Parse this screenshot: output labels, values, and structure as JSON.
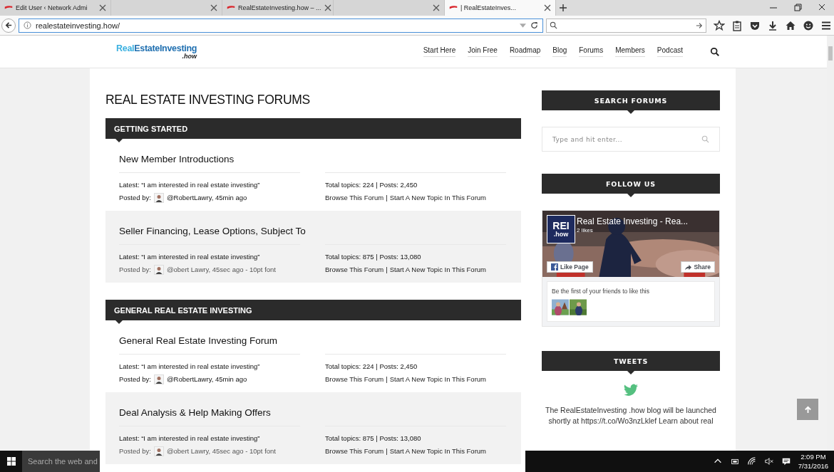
{
  "browser": {
    "tabs": [
      {
        "title": "Edit User ‹ Network Admi",
        "has_icon": true,
        "selected": false
      },
      {
        "has_icon": false,
        "selected": false
      },
      {
        "title": "RealEstateInvesting.how – ...",
        "has_icon": true,
        "selected": false
      },
      {
        "has_icon": false,
        "selected": false
      },
      {
        "title": "| RealEstateInves...",
        "has_icon": true,
        "selected": true
      }
    ],
    "address": "realestateinvesting.how/"
  },
  "site": {
    "logo": {
      "part_a": "Real",
      "part_b": "EstateInvesting",
      "sub": ".how"
    },
    "nav": [
      "Start Here",
      "Join Free",
      "Roadmap",
      "Blog",
      "Forums",
      "Members",
      "Podcast"
    ],
    "title": "REAL ESTATE INVESTING FORUMS",
    "sections": [
      {
        "title": "GETTING STARTED",
        "forums": [
          {
            "name": "New Member Introductions",
            "shaded": false,
            "latest": "Latest: “I am interested in real estate investing”",
            "posted_label": "Posted by:",
            "author": "@RobertLawry, 45min ago",
            "stats": "Total topics: 224 | Posts: 2,450",
            "links": [
              "Browse This Forum",
              "Start A New Topic In This Forum"
            ],
            "separator": "|"
          },
          {
            "name": "Seller Financing, Lease Options, Subject To",
            "shaded": true,
            "latest": "Latest: “I am interested in real estate investing”",
            "posted_label": "Posted by:",
            "author": "@obert Lawry, 45sec ago - 10pt font",
            "stats": "Total topics: 875 | Posts: 13,080",
            "links": [
              "Browse This Forum",
              "Start A New Topic In This Forum"
            ],
            "separator": "|"
          }
        ]
      },
      {
        "title": "GENERAL REAL ESTATE INVESTING",
        "forums": [
          {
            "name": "General Real Estate Investing Forum",
            "shaded": false,
            "latest": "Latest: “I am interested in real estate investing”",
            "posted_label": "Posted by:",
            "author": "@RobertLawry, 45min ago",
            "stats": "Total topics: 224 | Posts: 2,450",
            "links": [
              "Browse This Forum",
              "Start A New Topic In This Forum"
            ],
            "separator": "|"
          },
          {
            "name": "Deal Analysis & Help Making Offers",
            "shaded": true,
            "latest": "Latest: “I am interested in real estate investing”",
            "posted_label": "Posted by:",
            "author": "@obert Lawry, 45sec ago - 10pt font",
            "stats": "Total topics: 875 | Posts: 13,080",
            "links": [
              "Browse This Forum",
              "Start A New Topic In This Forum"
            ],
            "separator": "|"
          }
        ]
      }
    ],
    "sidebar": [
      {
        "kind": "search",
        "title": "SEARCH FORUMS",
        "placeholder": "Type and hit enter..."
      },
      {
        "kind": "facebook",
        "title": "FOLLOW US",
        "page_name": "Real Estate Investing - Rea...",
        "likes": "2 likes",
        "logo_top": "REI",
        "logo_bottom": ".how",
        "like_button": "Like Page",
        "share_button": "Share",
        "friends_text": "Be the first of your friends to like this"
      },
      {
        "kind": "tweets",
        "title": "TWEETS",
        "text": "The RealEstateInvesting .how blog will be launched shortly at https://t.co/Wo3nzLklef Learn about real"
      }
    ]
  },
  "taskbar": {
    "search_placeholder": "Search the web and",
    "time": "2:09 PM",
    "date": "7/31/2016"
  }
}
